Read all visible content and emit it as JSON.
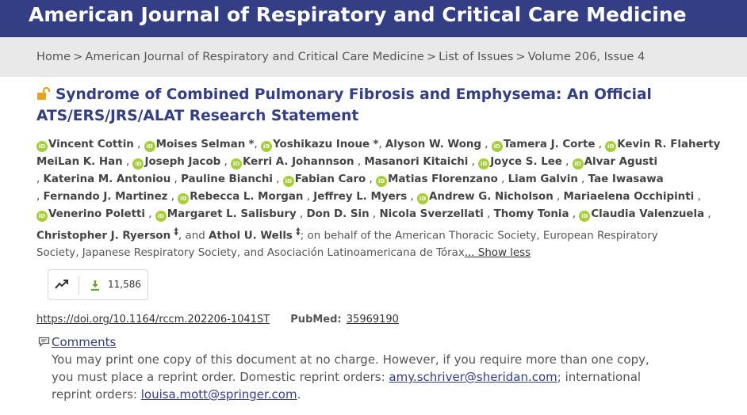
{
  "journal": {
    "title": "American Journal of Respiratory and Critical Care Medicine"
  },
  "breadcrumb": {
    "items": [
      "Home",
      "American Journal of Respiratory and Critical Care Medicine",
      "List of Issues",
      "Volume 206, Issue 4"
    ],
    "separator": ">"
  },
  "article": {
    "title_line1": "Syndrome of Combined Pulmonary Fibrosis and Emphysema: An Official",
    "title_line2": "ATS/ERS/JRS/ALAT Research Statement",
    "authors": [
      {
        "name": "Vincent Cottin",
        "orcid": true,
        "mark": ""
      },
      {
        "name": "Moises Selman",
        "orcid": true,
        "mark": "*"
      },
      {
        "name": "Yoshikazu Inoue",
        "orcid": true,
        "mark": "*"
      },
      {
        "name": "Alyson W. Wong",
        "orcid": false,
        "mark": ""
      },
      {
        "name": "Tamera J. Corte",
        "orcid": true,
        "mark": ""
      },
      {
        "name": "Kevin R. Flaherty",
        "orcid": true,
        "mark": ""
      },
      {
        "name": "MeiLan K. Han",
        "orcid": false,
        "mark": ""
      },
      {
        "name": "Joseph Jacob",
        "orcid": true,
        "mark": ""
      },
      {
        "name": "Kerri A. Johannson",
        "orcid": true,
        "mark": ""
      },
      {
        "name": "Masanori Kitaichi",
        "orcid": false,
        "mark": ""
      },
      {
        "name": "Joyce S. Lee",
        "orcid": true,
        "mark": ""
      },
      {
        "name": "Alvar Agusti",
        "orcid": true,
        "mark": ""
      },
      {
        "name": "Katerina M. Antoniou",
        "orcid": false,
        "mark": ""
      },
      {
        "name": "Pauline Bianchi",
        "orcid": false,
        "mark": ""
      },
      {
        "name": "Fabian Caro",
        "orcid": true,
        "mark": ""
      },
      {
        "name": "Matias Florenzano",
        "orcid": true,
        "mark": ""
      },
      {
        "name": "Liam Galvin",
        "orcid": false,
        "mark": ""
      },
      {
        "name": "Tae Iwasawa",
        "orcid": false,
        "mark": ""
      },
      {
        "name": "Fernando J. Martinez",
        "orcid": false,
        "mark": ""
      },
      {
        "name": "Rebecca L. Morgan",
        "orcid": true,
        "mark": ""
      },
      {
        "name": "Jeffrey L. Myers",
        "orcid": false,
        "mark": ""
      },
      {
        "name": "Andrew G. Nicholson",
        "orcid": true,
        "mark": ""
      },
      {
        "name": "Mariaelena Occhipinti",
        "orcid": false,
        "mark": ""
      },
      {
        "name": "Venerino Poletti",
        "orcid": true,
        "mark": ""
      },
      {
        "name": "Margaret L. Salisbury",
        "orcid": true,
        "mark": ""
      },
      {
        "name": "Don D. Sin",
        "orcid": false,
        "mark": ""
      },
      {
        "name": "Nicola Sverzellati",
        "orcid": false,
        "mark": ""
      },
      {
        "name": "Thomy Tonia",
        "orcid": false,
        "mark": ""
      },
      {
        "name": "Claudia Valenzuela",
        "orcid": true,
        "mark": ""
      },
      {
        "name": "Christopher J. Ryerson",
        "orcid": false,
        "mark": "‡"
      },
      {
        "name": "Athol U. Wells",
        "orcid": false,
        "mark": "‡"
      }
    ],
    "and_text": "and",
    "affiliation_line1": "; on behalf of the American Thoracic Society, European Respiratory",
    "affiliation_line2": "Society, Japanese Respiratory Society, and Asociación Latinoamericana de Tórax",
    "show_less": "... Show less",
    "orcid_label": "iD"
  },
  "metrics": {
    "downloads": "11,586",
    "trend_icon": "trending-up-icon",
    "download_icon": "download-icon"
  },
  "doi": {
    "text": "https://doi.org/10.1164/rccm.202206-1041ST"
  },
  "pubmed": {
    "label": "PubMed:",
    "id": "35969190"
  },
  "comments": {
    "label": "Comments"
  },
  "reprint": {
    "text1": "You may print one copy of this document at no charge. However, if you require more than one copy, you must place a reprint order. Domestic reprint orders: ",
    "email1": "amy.schriver@sheridan.com",
    "text2": "; international reprint orders: ",
    "email2": "louisa.mott@springer.com",
    "text3": "."
  },
  "colors": {
    "header": "#333e85",
    "breadcrumb_bg": "#e9e9e9",
    "orcid": "#a6ce39",
    "lock": "#e8a21b",
    "download": "#6aa72f"
  }
}
